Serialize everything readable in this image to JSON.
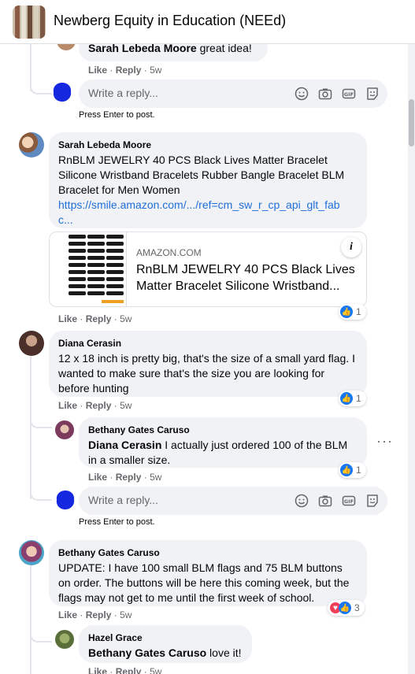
{
  "header": {
    "title": "Newberg Equity in Education (NEEd)"
  },
  "comments": {
    "c0": {
      "author": "Sarah Lebeda Moore",
      "text": " great idea!",
      "like": "Like",
      "reply": "Reply",
      "time": "5w"
    },
    "c1": {
      "author": "Sarah Lebeda Moore",
      "text": "RnBLM JEWELRY 40 PCS Black Lives Matter Bracelet Silicone Wristband Bracelets Rubber Bangle Bracelet BLM Bracelet for Men Women",
      "link": "https://smile.amazon.com/.../ref=cm_sw_r_cp_api_glt_fab",
      "link2": "c...",
      "card": {
        "domain": "AMAZON.COM",
        "title": "RnBLM JEWELRY 40 PCS Black Lives Matter Bracelet Silicone Wristband...",
        "info": "i"
      },
      "like": "Like",
      "reply": "Reply",
      "time": "5w",
      "reactions": "1"
    },
    "c2": {
      "author": "Diana Cerasin",
      "text": "12 x 18 inch is pretty big, that's the size of a small yard flag. I wanted to make sure that's the size you are looking for before hunting",
      "like": "Like",
      "reply": "Reply",
      "time": "5w",
      "reactions": "1"
    },
    "c2r": {
      "author": "Bethany Gates Caruso",
      "mention": "Diana Cerasin",
      "text": " I actually just ordered 100 of the BLM in a smaller size.",
      "like": "Like",
      "reply": "Reply",
      "time": "5w",
      "reactions": "1"
    },
    "c3": {
      "author": "Bethany Gates Caruso",
      "text": "UPDATE: I have 100 small BLM flags and 75 BLM buttons on order. The buttons will be here this coming week, but the flags may not get to me until the first week of school.",
      "like": "Like",
      "reply": "Reply",
      "time": "5w",
      "reactions": "3"
    },
    "c3r": {
      "author": "Hazel Grace",
      "mention": "Bethany Gates Caruso",
      "text": " love it!",
      "like": "Like",
      "reply": "Reply",
      "time": "5w"
    }
  },
  "reply_box": {
    "placeholder": "Write a reply...",
    "hint": "Press Enter to post."
  },
  "separator": "·",
  "icons": [
    "smiley-icon",
    "camera-icon",
    "gif-icon",
    "sticker-icon",
    "like-reaction-icon",
    "love-reaction-icon",
    "more-options-icon"
  ],
  "colors": {
    "accent": "#1877f2",
    "link": "#216fdb",
    "bubble": "#f0f2f5",
    "love": "#f33e58"
  }
}
